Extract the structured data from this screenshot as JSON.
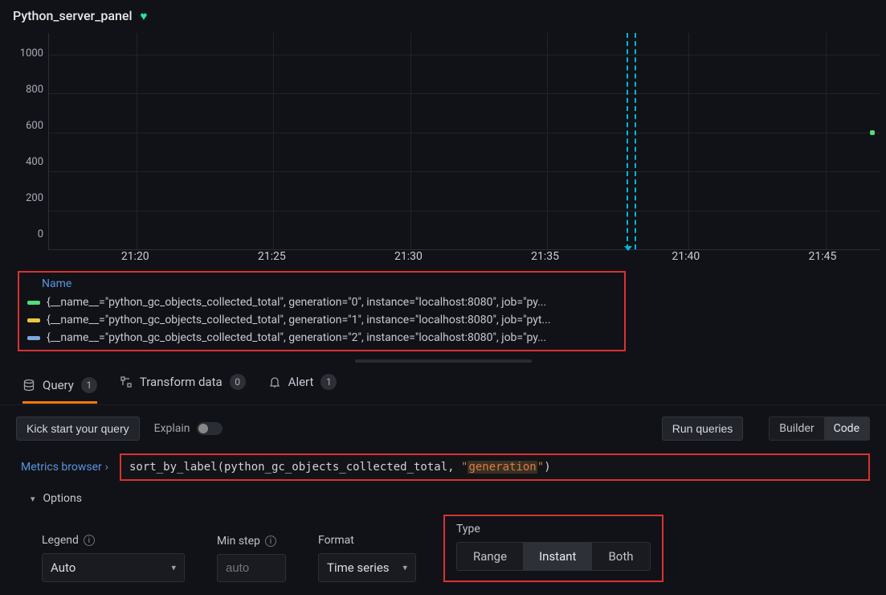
{
  "panel": {
    "title": "Python_server_panel",
    "health_icon": "heart-icon"
  },
  "chart_data": {
    "type": "line",
    "title": "Python_server_panel",
    "ylabel": "",
    "xlabel": "",
    "ylim": [
      0,
      1000
    ],
    "y_ticks": [
      "1000",
      "800",
      "600",
      "400",
      "200",
      "0"
    ],
    "x_ticks": [
      "21:20",
      "21:25",
      "21:30",
      "21:35",
      "21:40",
      "21:45"
    ],
    "cursor_time": "21:37",
    "series": [
      {
        "name": "{__name__=\"python_gc_objects_collected_total\", generation=\"0\", instance=\"localhost:8080\", job=\"py...",
        "color": "#56d97a",
        "values": []
      },
      {
        "name": "{__name__=\"python_gc_objects_collected_total\", generation=\"1\", instance=\"localhost:8080\", job=\"pyt...",
        "color": "#e8c93c",
        "values": []
      },
      {
        "name": "{__name__=\"python_gc_objects_collected_total\", generation=\"2\", instance=\"localhost:8080\", job=\"py...",
        "color": "#7ea8e0",
        "values": []
      }
    ],
    "annotations": [
      {
        "series": 0,
        "x": "21:46",
        "y": 550
      }
    ]
  },
  "legend": {
    "header": "Name"
  },
  "tabs": {
    "query": {
      "label": "Query",
      "count": "1"
    },
    "transform": {
      "label": "Transform data",
      "count": "0"
    },
    "alert": {
      "label": "Alert",
      "count": "1"
    }
  },
  "toolbar": {
    "kick_start": "Kick start your query",
    "explain": "Explain",
    "run": "Run queries",
    "mode": {
      "builder": "Builder",
      "code": "Code",
      "active": "code"
    }
  },
  "metrics_browser": {
    "label": "Metrics browser"
  },
  "query": {
    "prefix": "sort_by_label(python_gc_objects_collected_total, ",
    "string_open": "\"",
    "string_highlight": "generation",
    "string_close": "\"",
    "suffix": ")"
  },
  "options": {
    "title": "Options",
    "legend": {
      "label": "Legend",
      "value": "Auto"
    },
    "min_step": {
      "label": "Min step",
      "placeholder": "auto"
    },
    "format": {
      "label": "Format",
      "value": "Time series"
    },
    "type": {
      "label": "Type",
      "options": {
        "range": "Range",
        "instant": "Instant",
        "both": "Both"
      },
      "active": "instant"
    }
  }
}
